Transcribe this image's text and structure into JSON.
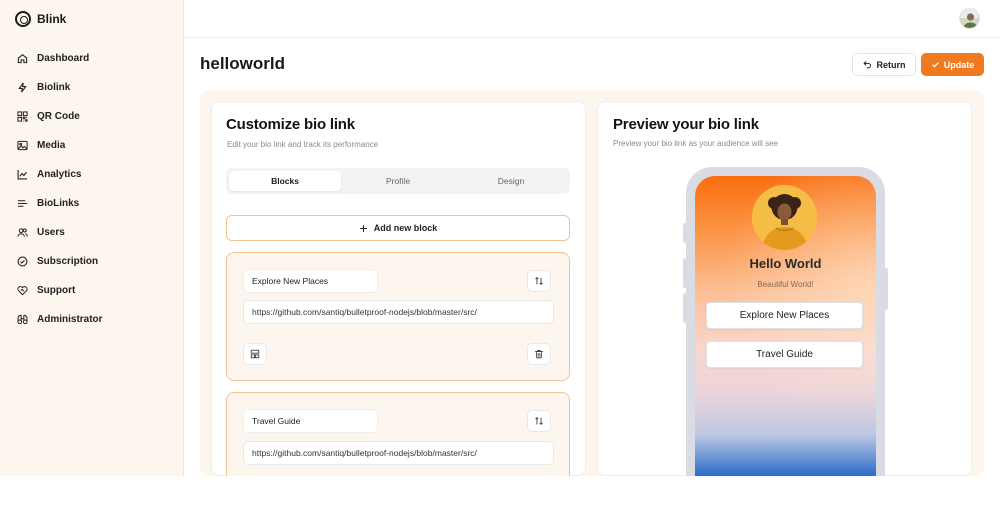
{
  "app": {
    "brand": "Blink"
  },
  "sidebar": {
    "items": [
      {
        "label": "Dashboard",
        "icon": "home-icon"
      },
      {
        "label": "Biolink",
        "icon": "bolt-icon"
      },
      {
        "label": "QR Code",
        "icon": "qr-code-icon"
      },
      {
        "label": "Media",
        "icon": "image-icon"
      },
      {
        "label": "Analytics",
        "icon": "chart-line-icon"
      },
      {
        "label": "BioLinks",
        "icon": "list-icon"
      },
      {
        "label": "Users",
        "icon": "users-icon"
      },
      {
        "label": "Subscription",
        "icon": "check-circle-icon"
      },
      {
        "label": "Support",
        "icon": "heart-handshake-icon"
      },
      {
        "label": "Administrator",
        "icon": "binoculars-icon"
      }
    ]
  },
  "header": {
    "title": "helloworld",
    "return_label": "Return",
    "update_label": "Update"
  },
  "colors": {
    "accent": "#f07a1f",
    "border_accent": "#f2c494",
    "sidebar_bg": "#fdf6ee"
  },
  "customize": {
    "title": "Customize bio link",
    "subtitle": "Edit your bio link and track its performance",
    "tabs": [
      "Blocks",
      "Profile",
      "Design"
    ],
    "active_tab": "Blocks",
    "add_block_label": "Add new block",
    "blocks": [
      {
        "name": "Explore New Places",
        "url": "https://github.com/santiq/bulletproof-nodejs/blob/master/src/"
      },
      {
        "name": "Travel Guide",
        "url": "https://github.com/santiq/bulletproof-nodejs/blob/master/src/"
      }
    ]
  },
  "preview": {
    "title": "Preview your bio link",
    "subtitle": "Preview your bio link as your audience will see",
    "profile_name": "Hello World",
    "profile_bio": "Beautiful World!",
    "links": [
      "Explore New Places",
      "Travel Guide"
    ]
  }
}
